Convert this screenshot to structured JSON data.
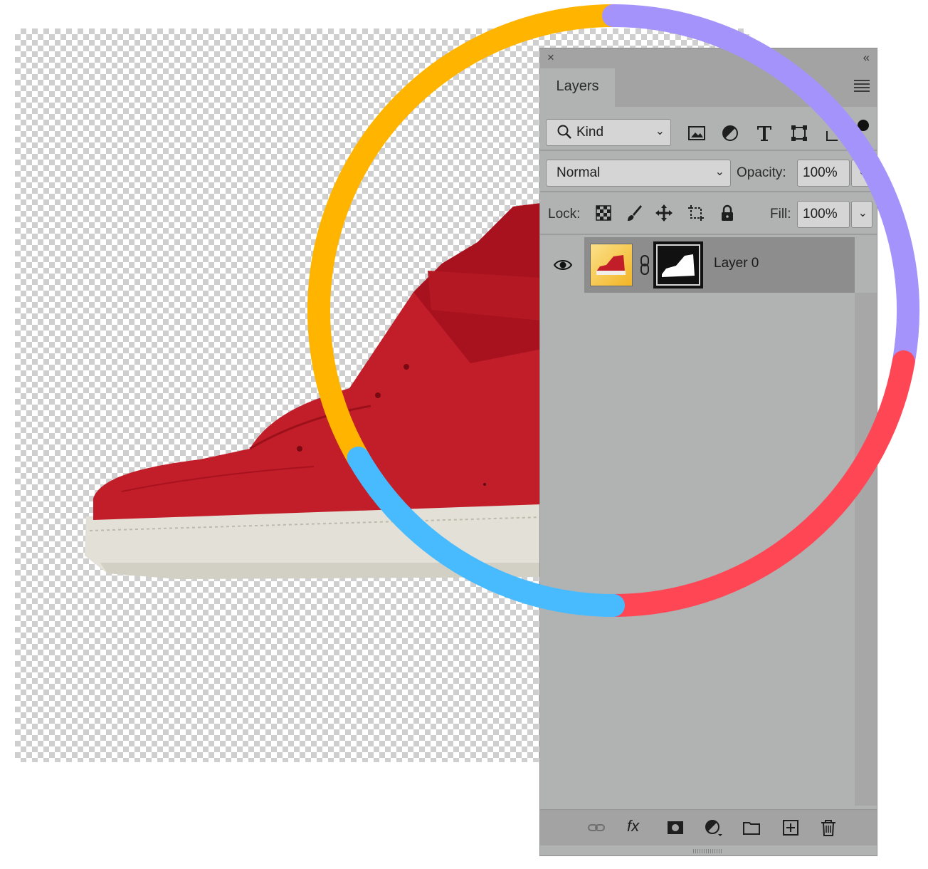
{
  "panel": {
    "close_glyph": "×",
    "collapse_glyph": "‹‹",
    "tab_label": "Layers",
    "filter": {
      "value": "Kind",
      "icon": "search-icon"
    },
    "filter_icons": [
      "image-filter-icon",
      "adjustment-filter-icon",
      "type-filter-icon",
      "shape-filter-icon",
      "smart-object-filter-icon",
      "filter-toggle-icon"
    ],
    "blend_mode": "Normal",
    "opacity_label": "Opacity:",
    "opacity_value": "100%",
    "lock_label": "Lock:",
    "lock_icons": [
      "lock-transparent-icon",
      "lock-image-icon",
      "lock-position-icon",
      "lock-artboard-icon",
      "lock-all-icon"
    ],
    "fill_label": "Fill:",
    "fill_value": "100%",
    "layers": [
      {
        "name": "Layer 0",
        "visible": true,
        "has_mask": true,
        "selected": true
      }
    ],
    "footer_icons": [
      "link-layers-icon",
      "fx-icon",
      "add-mask-icon",
      "adjustment-layer-icon",
      "group-folder-icon",
      "new-layer-icon",
      "trash-icon"
    ],
    "fx_text": "fx"
  },
  "colors": {
    "ring_yellow": "#FFB400",
    "ring_purple": "#A393FA",
    "ring_red": "#FF4655",
    "ring_blue": "#48BBFF",
    "shoe_red": "#C21E2A",
    "panel_bg": "#B1B2B2"
  }
}
